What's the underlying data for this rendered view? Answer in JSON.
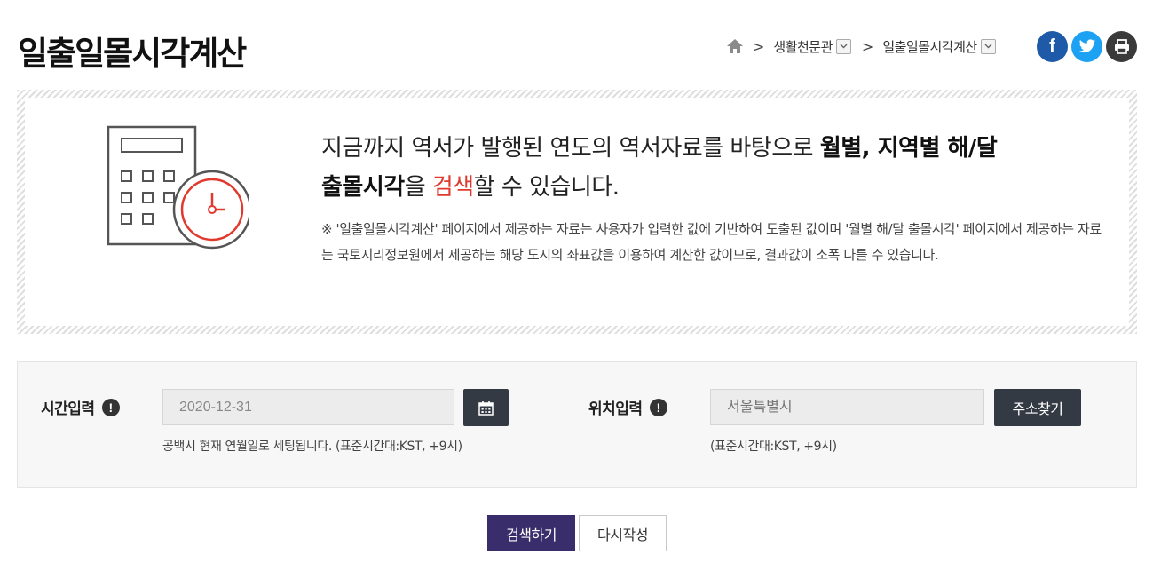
{
  "page": {
    "title": "일출일몰시각계산"
  },
  "breadcrumb": {
    "home_icon": "home-icon",
    "items": [
      {
        "label": "생활천문관"
      },
      {
        "label": "일출일몰시각계산"
      }
    ]
  },
  "share": {
    "facebook_glyph": "f",
    "icons": [
      "facebook-icon",
      "twitter-icon",
      "print-icon"
    ]
  },
  "intro": {
    "headline_part1": "지금까지 역서가 발행된 연도의 역서자료를 바탕으로 ",
    "headline_bold1": "월별, 지역별 해/달",
    "headline_bold2": "출몰시각",
    "headline_part2": "을 ",
    "headline_red": "검색",
    "headline_part3": "할 수 있습니다.",
    "note": "※ '일출일몰시각계산' 페이지에서 제공하는 자료는 사용자가 입력한 값에 기반하여 도출된 값이며 '월별 해/달 출몰시각' 페이지에서 제공하는 자료는 국토지리정보원에서 제공하는 해당 도시의 좌표값을 이용하여 계산한 값이므로, 결과값이 소폭 다를 수 있습니다."
  },
  "form": {
    "time": {
      "label": "시간입력",
      "info_glyph": "!",
      "value": "2020-12-31",
      "help": "공백시 현재 연월일로 세팅됩니다. (표준시간대:KST, +9시)"
    },
    "location": {
      "label": "위치입력",
      "info_glyph": "!",
      "placeholder": "서울특별시",
      "button": "주소찾기",
      "help": "(표준시간대:KST, +9시)"
    }
  },
  "actions": {
    "search": "검색하기",
    "reset": "다시작성"
  },
  "colors": {
    "accent_purple": "#3a2d6b",
    "dark_button": "#333a44",
    "highlight_red": "#e03a2e",
    "facebook": "#1e5aa8",
    "twitter": "#1da1f2"
  }
}
